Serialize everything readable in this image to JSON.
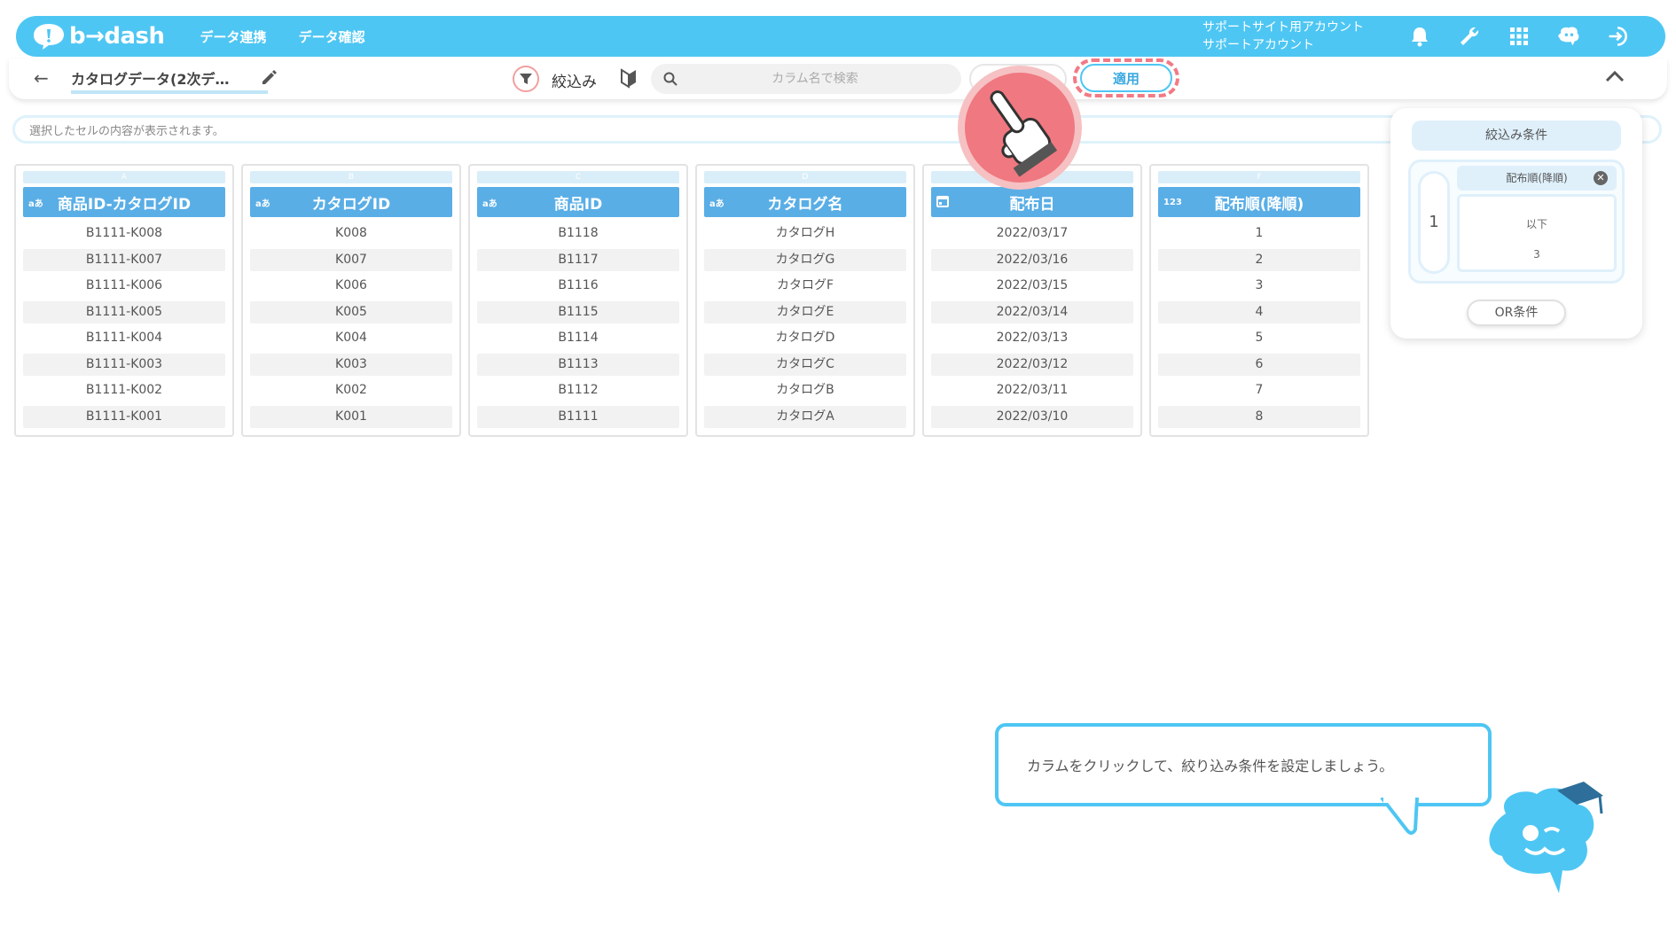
{
  "brand": {
    "logo_text": "b→dash",
    "color": "#4ec6f3"
  },
  "nav": {
    "items": [
      "データ連携",
      "データ確認"
    ]
  },
  "account": {
    "line1": "サポートサイト用アカウント",
    "line2": "サポートアカウント"
  },
  "top_icons": [
    "bell-icon",
    "wrench-icon",
    "apps-grid-icon",
    "mascot-icon",
    "logout-icon"
  ],
  "toolbar": {
    "back_label": "←",
    "dataset_title": "カタログデータ(2次デ…",
    "filter_label": "絞込み",
    "search_placeholder": "カラム名で検索",
    "apply_label": "適用",
    "collapse_label": "︿"
  },
  "cellbar": {
    "placeholder": "選択したセルの内容が表示されます。"
  },
  "columns": [
    {
      "letter": "A",
      "type": "aあ",
      "name": "商品ID-カタログID",
      "cells": [
        "B1111-K008",
        "B1111-K007",
        "B1111-K006",
        "B1111-K005",
        "B1111-K004",
        "B1111-K003",
        "B1111-K002",
        "B1111-K001"
      ]
    },
    {
      "letter": "B",
      "type": "aあ",
      "name": "カタログID",
      "cells": [
        "K008",
        "K007",
        "K006",
        "K005",
        "K004",
        "K003",
        "K002",
        "K001"
      ]
    },
    {
      "letter": "C",
      "type": "aあ",
      "name": "商品ID",
      "cells": [
        "B1118",
        "B1117",
        "B1116",
        "B1115",
        "B1114",
        "B1113",
        "B1112",
        "B1111"
      ]
    },
    {
      "letter": "D",
      "type": "aあ",
      "name": "カタログ名",
      "cells": [
        "カタログH",
        "カタログG",
        "カタログF",
        "カタログE",
        "カタログD",
        "カタログC",
        "カタログB",
        "カタログA"
      ]
    },
    {
      "letter": "",
      "type": "",
      "name": "配布日",
      "cells": [
        "2022/03/17",
        "2022/03/16",
        "2022/03/15",
        "2022/03/14",
        "2022/03/13",
        "2022/03/12",
        "2022/03/11",
        "2022/03/10"
      ]
    },
    {
      "letter": "F",
      "type": "123",
      "name": "配布順(降順)",
      "cells": [
        "1",
        "2",
        "3",
        "4",
        "5",
        "6",
        "7",
        "8"
      ]
    }
  ],
  "filter_panel": {
    "title": "絞込み条件",
    "group_index": "1",
    "condition": {
      "column": "配布順(降順)",
      "operator": "以下",
      "value": "3"
    },
    "or_label": "OR条件"
  },
  "tutorial": {
    "message": "カラムをクリックして、絞り込み条件を設定しましょう。"
  }
}
